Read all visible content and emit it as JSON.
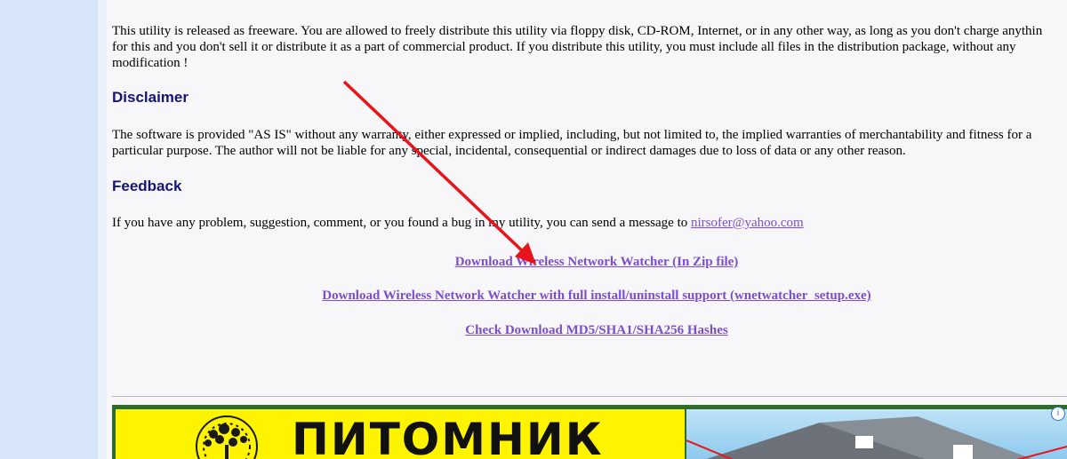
{
  "license_text_line1": "This utility is released as freeware. You are allowed to freely distribute this utility via floppy disk, CD-ROM, Internet, or in any other way, as long as you don't charge anythin",
  "license_text_line2": "for this and you don't sell it or distribute it as a part of commercial product. If you distribute this utility, you must include all files in the distribution package, without any",
  "license_text_line3": "modification !",
  "disclaimer": {
    "heading": "Disclaimer",
    "line1": "The software is provided \"AS IS\" without any warranty, either expressed or implied, including, but not limited to, the implied warranties of merchantability and fitness for a",
    "line2": "particular purpose. The author will not be liable for any special, incidental, consequential or indirect damages due to loss of data or any other reason."
  },
  "feedback": {
    "heading": "Feedback",
    "text": "If you have any problem, suggestion, comment, or you found a bug in my utility, you can send a message to ",
    "email": "nirsofer@yahoo.com"
  },
  "downloads": {
    "zip": "Download Wireless Network Watcher (In Zip file)",
    "setup": "Download Wireless Network Watcher with full install/uninstall support (wnetwatcher_setup.exe)",
    "hashes": "Check Download MD5/SHA1/SHA256 Hashes"
  },
  "ad": {
    "title": "ПИТОМНИК",
    "info_glyph": "i"
  },
  "colors": {
    "sidebar": "#d6e6f8",
    "heading": "#151577",
    "link": "#7c4dcc",
    "arrow": "#e8141b",
    "ad_yellow": "#fff400"
  }
}
